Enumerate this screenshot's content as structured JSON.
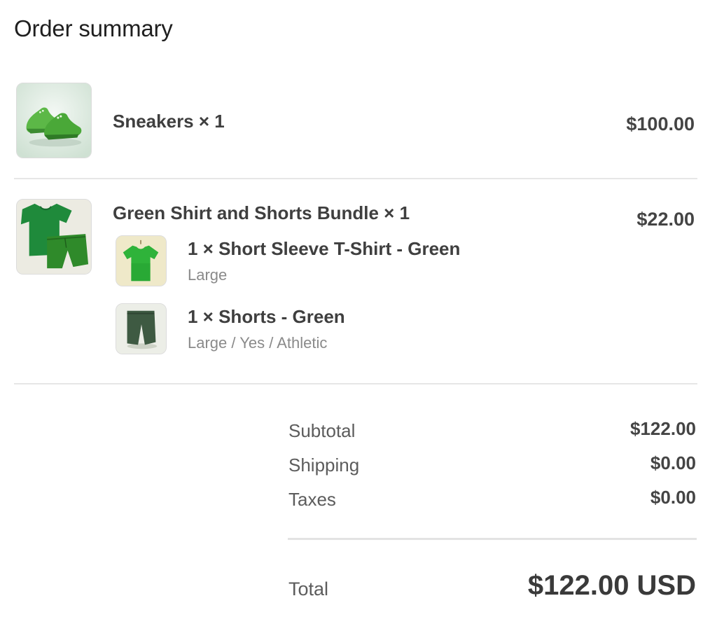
{
  "header": {
    "title": "Order summary"
  },
  "line_items": [
    {
      "name": "Sneakers × 1",
      "price": "$100.00",
      "image_icon": "sneakers-image"
    },
    {
      "name": "Green Shirt and Shorts Bundle × 1",
      "price": "$22.00",
      "image_icon": "shirt-shorts-bundle-image",
      "components": [
        {
          "name": "1 × Short Sleeve T-Shirt - Green",
          "variant": "Large",
          "image_icon": "tshirt-image"
        },
        {
          "name": "1 × Shorts - Green",
          "variant": "Large / Yes / Athletic",
          "image_icon": "shorts-image"
        }
      ]
    }
  ],
  "summary": {
    "subtotal_label": "Subtotal",
    "subtotal_value": "$122.00",
    "shipping_label": "Shipping",
    "shipping_value": "$0.00",
    "taxes_label": "Taxes",
    "taxes_value": "$0.00",
    "total_label": "Total",
    "total_value": "$122.00 USD"
  },
  "colors": {
    "product_green": "#3a9a2e",
    "divider": "#e6e6e6"
  }
}
